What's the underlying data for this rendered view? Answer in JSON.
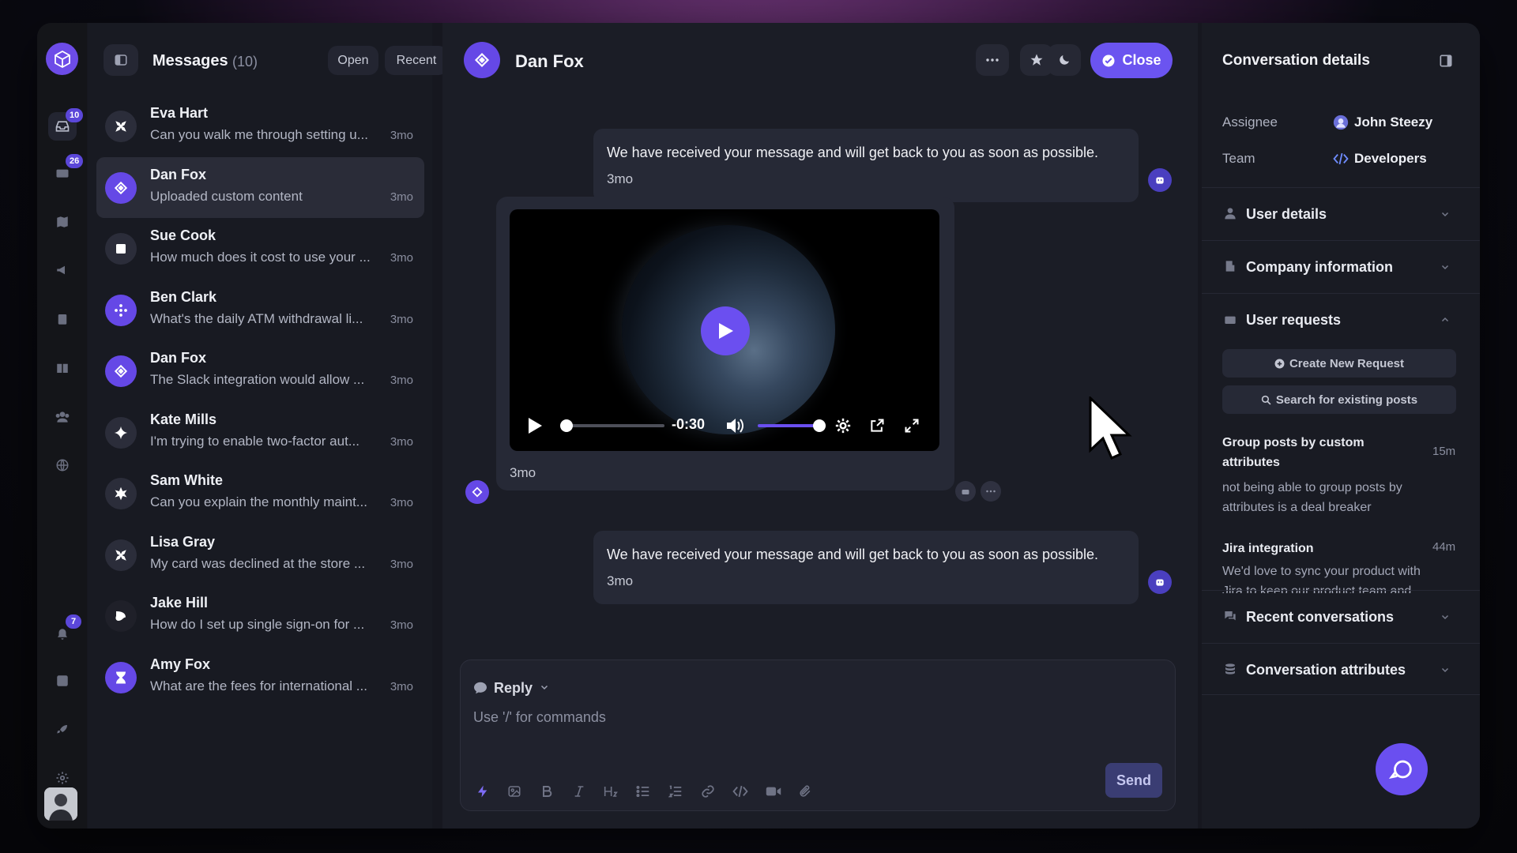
{
  "rail": {
    "badges": {
      "inbox": "10",
      "tickets": "26",
      "notifications": "7"
    },
    "icons": [
      "app-logo-icon",
      "inbox-icon",
      "tickets-icon",
      "map-icon",
      "megaphone-icon",
      "clipboard-icon",
      "book-icon",
      "users-icon",
      "globe-icon",
      "bell-icon",
      "chart-icon",
      "rocket-icon",
      "gear-icon",
      "avatar"
    ]
  },
  "messages": {
    "title": "Messages",
    "count": "(10)",
    "filters": {
      "open": "Open",
      "recent": "Recent"
    },
    "items": [
      {
        "name": "Eva Hart",
        "preview": "Can you walk me through setting u...",
        "time": "3mo",
        "icon": "x-mark-icon",
        "color": "#2b2d3a"
      },
      {
        "name": "Dan Fox",
        "preview": "Uploaded custom content",
        "time": "3mo",
        "icon": "diamond-icon",
        "color": "#6548e6"
      },
      {
        "name": "Sue Cook",
        "preview": "How much does it cost to use your ...",
        "time": "3mo",
        "icon": "square-icon",
        "color": "#2b2d3a"
      },
      {
        "name": "Ben Clark",
        "preview": "What's the daily ATM withdrawal li...",
        "time": "3mo",
        "icon": "dots-cross-icon",
        "color": "#6548e6"
      },
      {
        "name": "Dan Fox",
        "preview": "The Slack integration would allow ...",
        "time": "3mo",
        "icon": "diamond-icon",
        "color": "#6548e6"
      },
      {
        "name": "Kate Mills",
        "preview": "I'm trying to enable two-factor aut...",
        "time": "3mo",
        "icon": "sparkle-icon",
        "color": "#2b2d3a"
      },
      {
        "name": "Sam White",
        "preview": "Can you explain the monthly maint...",
        "time": "3mo",
        "icon": "star-burst-icon",
        "color": "#2b2d3a"
      },
      {
        "name": "Lisa Gray",
        "preview": "My card was declined at the store ...",
        "time": "3mo",
        "icon": "x-mark-icon",
        "color": "#2b2d3a"
      },
      {
        "name": "Jake Hill",
        "preview": "How do I set up single sign-on for ...",
        "time": "3mo",
        "icon": "leaf-icon",
        "color": "#1f2029"
      },
      {
        "name": "Amy Fox",
        "preview": "What are the fees for international ...",
        "time": "3mo",
        "icon": "hourglass-icon",
        "color": "#6548e6"
      }
    ]
  },
  "chat": {
    "contact": "Dan Fox",
    "close_label": "Close",
    "messages": [
      {
        "text": "We have received your message and will get back to you as soon as possible.",
        "time": "3mo"
      },
      {
        "text": "We have received your message and will get back to you as soon as possible.",
        "time": "3mo"
      }
    ],
    "video": {
      "time": "-0:30",
      "message_time": "3mo",
      "progress": 0.0,
      "volume": 1.0
    },
    "composer": {
      "mode": "Reply",
      "placeholder": "Use '/' for commands",
      "send": "Send"
    },
    "toolbar": [
      "bolt-icon",
      "image-icon",
      "bold-icon",
      "italic-icon",
      "heading-icon",
      "bullet-list-icon",
      "numbered-list-icon",
      "link-icon",
      "code-icon",
      "video-icon",
      "attachment-icon"
    ]
  },
  "details": {
    "title": "Conversation details",
    "assignee_label": "Assignee",
    "assignee_value": "John Steezy",
    "team_label": "Team",
    "team_value": "Developers",
    "sections": {
      "user_details": "User details",
      "company_information": "Company information",
      "user_requests": "User requests",
      "recent_conversations": "Recent conversations",
      "conversation_attributes": "Conversation attributes"
    },
    "create_request": "Create New Request",
    "search_posts": "Search for existing posts",
    "requests": [
      {
        "title": "Group posts by custom attributes",
        "time": "15m",
        "body": "not being able to group posts by attributes is a deal breaker"
      },
      {
        "title": "Jira integration",
        "time": "44m",
        "body": "We'd love to sync your product with Jira to keep our product team and"
      }
    ]
  },
  "colors": {
    "accent": "#6b54f0",
    "background": "#16171f"
  }
}
